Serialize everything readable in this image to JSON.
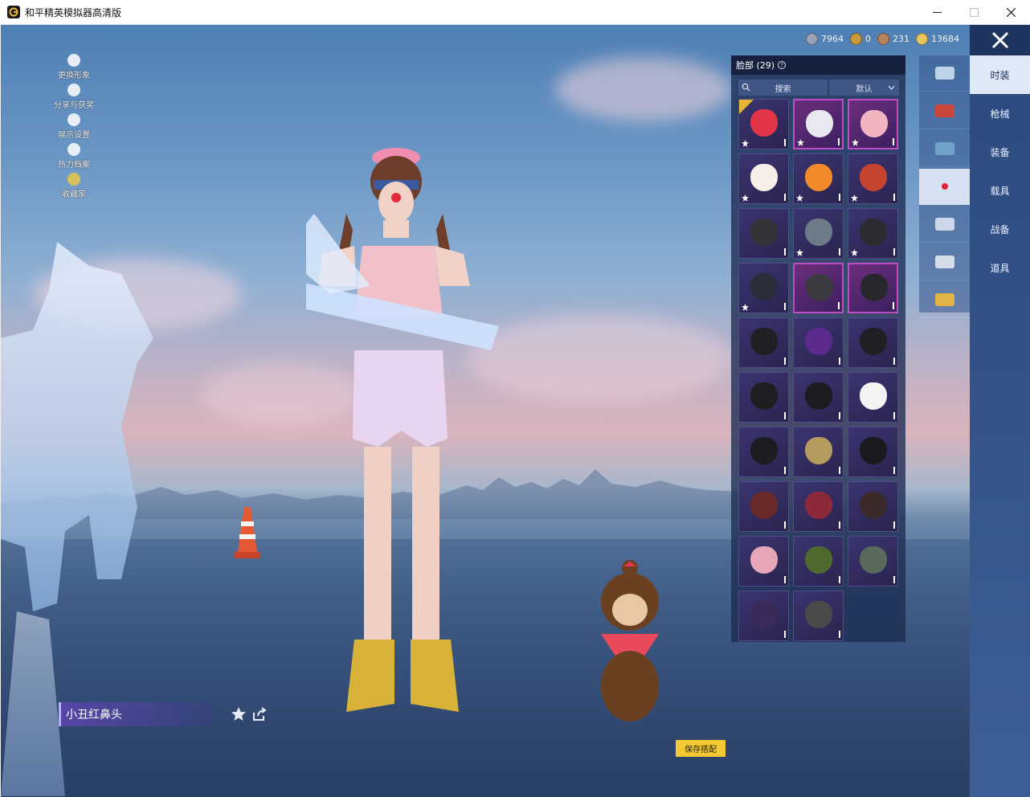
{
  "window": {
    "title": "和平精英模拟器高清版",
    "minimize_label": "",
    "maximize_label": "",
    "close_label": ""
  },
  "left_menu": [
    {
      "label": "更换形象",
      "icon": "avatar-icon"
    },
    {
      "label": "分享与获奖",
      "icon": "puzzle-icon"
    },
    {
      "label": "展示设置",
      "icon": "eye-icon"
    },
    {
      "label": "热力档案",
      "icon": "flame-icon"
    },
    {
      "label": "收藏家",
      "icon": "collector-badge-icon"
    }
  ],
  "currency": [
    {
      "value": "7964",
      "icon": "coin-silver-icon",
      "color": "#9aa2b4"
    },
    {
      "value": "0",
      "icon": "coin-gold-ring-icon",
      "color": "#c99b3b"
    },
    {
      "value": "231",
      "icon": "coin-bronze-icon",
      "color": "#b9835a"
    },
    {
      "value": "13684",
      "icon": "coin-gold-icon",
      "color": "#e7c65e"
    }
  ],
  "categories": [
    {
      "label": "时装",
      "active": true
    },
    {
      "label": "枪械",
      "active": false
    },
    {
      "label": "装备",
      "active": false
    },
    {
      "label": "载具",
      "active": false
    },
    {
      "label": "战备",
      "active": false
    },
    {
      "label": "道具",
      "active": false
    }
  ],
  "sub_tabs": [
    {
      "icon": "hat-icon",
      "color": "#bcd3ea",
      "active": false
    },
    {
      "icon": "glove-icon",
      "color": "#c9473a",
      "active": false
    },
    {
      "icon": "shoe-icon",
      "color": "#6fa2c8",
      "active": false
    },
    {
      "icon": "face-icon",
      "color": "#e0233b",
      "active": true
    },
    {
      "icon": "backpack-icon",
      "color": "#cbd7e8",
      "active": false
    },
    {
      "icon": "vehicle-icon",
      "color": "#d5dde8",
      "active": false
    },
    {
      "icon": "wings-icon",
      "color": "#e2b448",
      "active": false
    }
  ],
  "panel": {
    "title": "脸部 (29)",
    "help": "?",
    "search_label": "搜索",
    "sort_label": "默认"
  },
  "items": [
    {
      "name": "clown-nose",
      "mask_color": "#e23648",
      "border": "normal",
      "star": true,
      "selected": true
    },
    {
      "name": "clown-mask",
      "mask_color": "#e8e8f0",
      "border": "pink",
      "star": true,
      "selected": false
    },
    {
      "name": "pig-mask",
      "mask_color": "#f2b5c0",
      "border": "pink",
      "star": true,
      "selected": false
    },
    {
      "name": "egg-face-mask",
      "mask_color": "#f7eee8",
      "border": "normal",
      "star": true,
      "selected": false
    },
    {
      "name": "orange-mask",
      "mask_color": "#f08a2a",
      "border": "normal",
      "star": true,
      "selected": false
    },
    {
      "name": "dive-goggles",
      "mask_color": "#c5442f",
      "border": "normal",
      "star": true,
      "selected": false
    },
    {
      "name": "black-respirator",
      "mask_color": "#333338",
      "border": "normal",
      "star": false,
      "selected": false
    },
    {
      "name": "scarf-mask",
      "mask_color": "#6d7a88",
      "border": "normal",
      "star": true,
      "selected": false
    },
    {
      "name": "plague-mask",
      "mask_color": "#2b2b30",
      "border": "normal",
      "star": true,
      "selected": false
    },
    {
      "name": "tactical-mask",
      "mask_color": "#2a2e3a",
      "border": "normal",
      "star": true,
      "selected": false
    },
    {
      "name": "gas-mask-pink",
      "mask_color": "#3a3a40",
      "border": "pink",
      "star": false,
      "selected": false
    },
    {
      "name": "half-mask-pink",
      "mask_color": "#28282c",
      "border": "pink",
      "star": false,
      "selected": false
    },
    {
      "name": "half-mask-1",
      "mask_color": "#1f1f24",
      "border": "normal",
      "star": false,
      "selected": false
    },
    {
      "name": "neon-mask",
      "mask_color": "#5b2a8c",
      "border": "normal",
      "star": false,
      "selected": false
    },
    {
      "name": "half-mask-2",
      "mask_color": "#202024",
      "border": "normal",
      "star": false,
      "selected": false
    },
    {
      "name": "half-mask-3",
      "mask_color": "#1d1d22",
      "border": "normal",
      "star": false,
      "selected": false
    },
    {
      "name": "half-mask-4",
      "mask_color": "#1b1b20",
      "border": "normal",
      "star": false,
      "selected": false
    },
    {
      "name": "white-beard",
      "mask_color": "#f3f3f3",
      "border": "normal",
      "star": false,
      "selected": false
    },
    {
      "name": "gas-mask-black",
      "mask_color": "#1c1c21",
      "border": "normal",
      "star": false,
      "selected": false
    },
    {
      "name": "khaki-scarf",
      "mask_color": "#b59a5d",
      "border": "normal",
      "star": false,
      "selected": false
    },
    {
      "name": "alan-walker-mask",
      "mask_color": "#191a1d",
      "border": "normal",
      "star": false,
      "selected": false
    },
    {
      "name": "red-visor-mask",
      "mask_color": "#6a2a2a",
      "border": "normal",
      "star": false,
      "selected": false
    },
    {
      "name": "red-demon-mask",
      "mask_color": "#8c2a3a",
      "border": "normal",
      "star": false,
      "selected": false
    },
    {
      "name": "balaclava-red",
      "mask_color": "#3a2a2a",
      "border": "normal",
      "star": false,
      "selected": false
    },
    {
      "name": "pink-face-mask",
      "mask_color": "#e7a6b8",
      "border": "normal",
      "star": false,
      "selected": false
    },
    {
      "name": "camo-scarf",
      "mask_color": "#4e6a2e",
      "border": "normal",
      "star": false,
      "selected": false
    },
    {
      "name": "helmet-mask",
      "mask_color": "#5a6a5a",
      "border": "normal",
      "star": false,
      "selected": false
    },
    {
      "name": "purple-mask",
      "mask_color": "#3a2a5a",
      "border": "normal",
      "star": false,
      "selected": false
    },
    {
      "name": "soldier-helmet",
      "mask_color": "#4a4a4a",
      "border": "normal",
      "star": false,
      "selected": false
    }
  ],
  "name_bar": {
    "label": "小丑红鼻头",
    "favorite_icon": "star-icon",
    "share_icon": "share-icon"
  },
  "save_button": "保存搭配"
}
